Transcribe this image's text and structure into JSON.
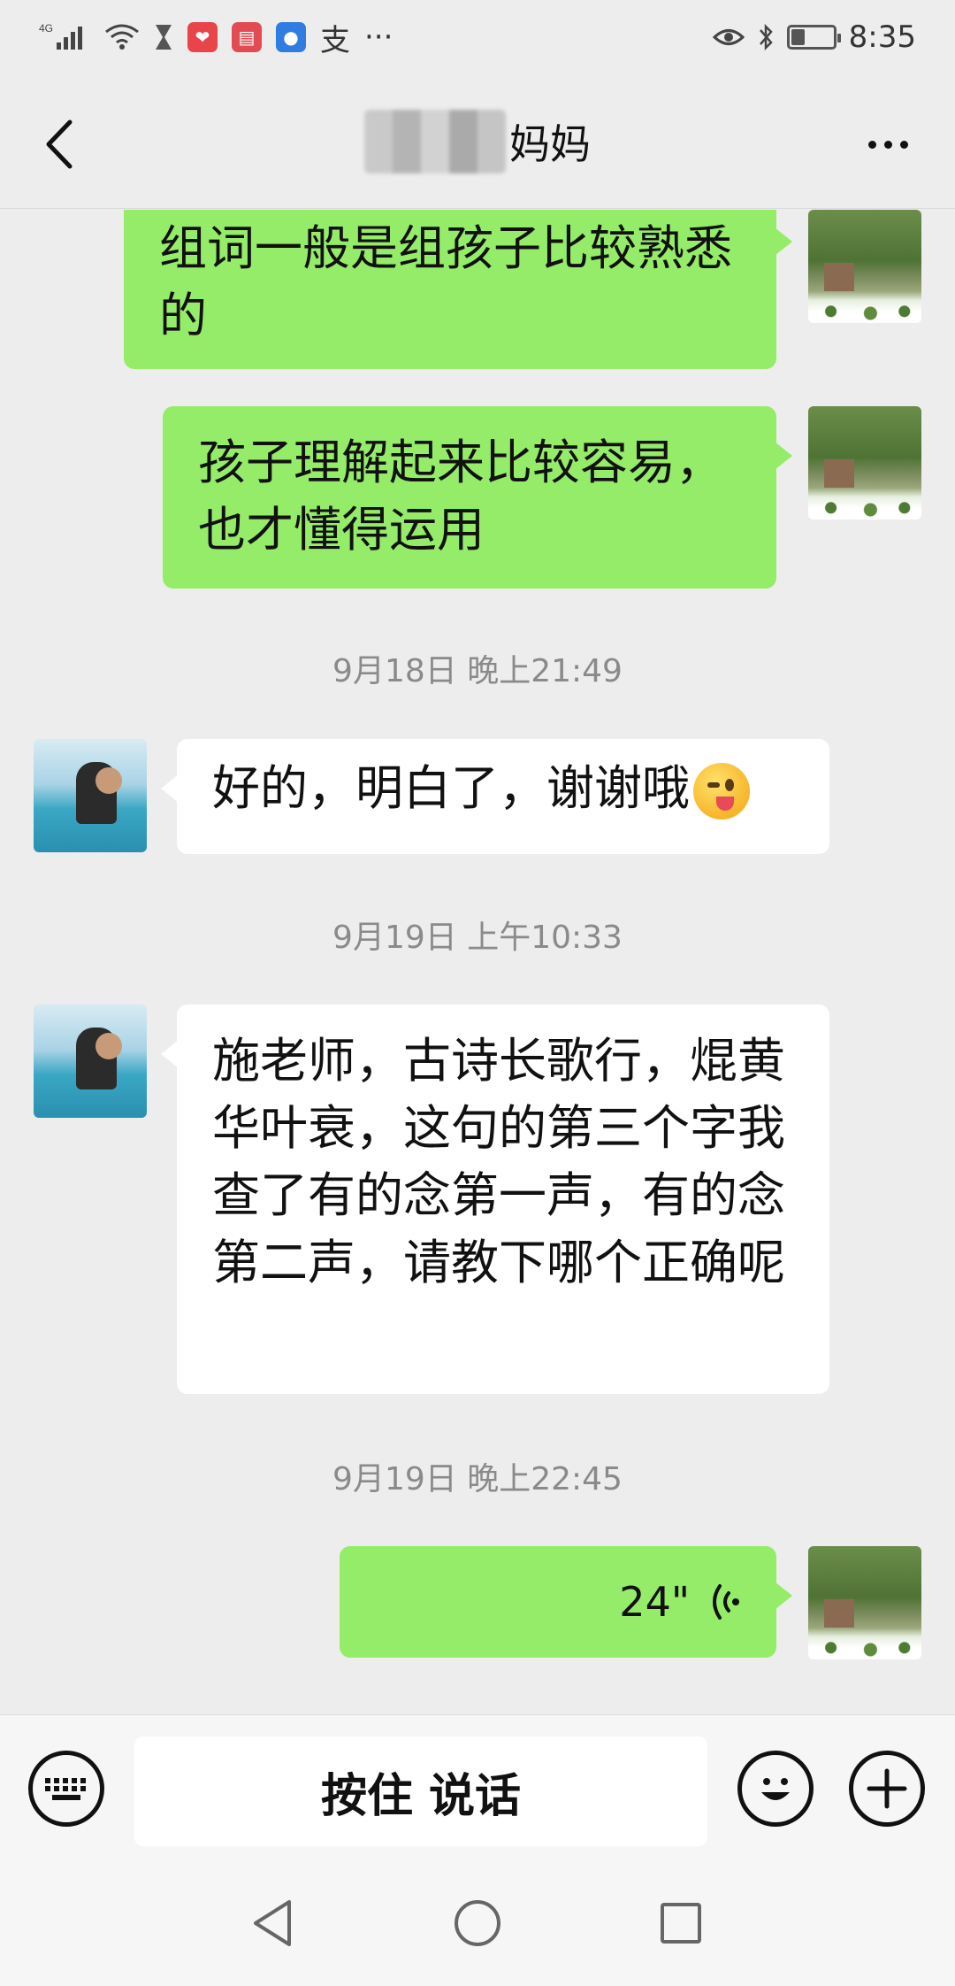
{
  "status_bar": {
    "network": "4G",
    "time": "8:35",
    "battery_level": 0.3
  },
  "header": {
    "title": "妈妈",
    "back_icon": "chevron-left-icon",
    "more_icon": "more-dots-icon"
  },
  "messages": [
    {
      "side": "me",
      "text": "组词一般是组孩子比较熟悉的"
    },
    {
      "side": "me",
      "text": "孩子理解起来比较容易，也才懂得运用"
    },
    {
      "type": "time",
      "text": "9月18日 晚上21:49"
    },
    {
      "side": "other",
      "text": "好的，明白了，谢谢哦",
      "emoji": "wink-tongue-emoji"
    },
    {
      "type": "time",
      "text": "9月19日 上午10:33"
    },
    {
      "side": "other",
      "text": "施老师，古诗长歌行，焜黄华叶衰，这句的第三个字我查了有的念第一声，有的念第二声，请教下哪个正确呢"
    },
    {
      "type": "time",
      "text": "9月19日 晚上22:45"
    },
    {
      "side": "me",
      "type": "voice",
      "duration": "24\""
    }
  ],
  "input_bar": {
    "hold_to_talk": "按住 说话",
    "keyboard_icon": "keyboard-icon",
    "emoji_icon": "smiley-icon",
    "plus_icon": "plus-icon"
  },
  "nav_bar": {
    "back_icon": "triangle-back-icon",
    "home_icon": "circle-home-icon",
    "recents_icon": "square-recents-icon"
  },
  "colors": {
    "background": "#ededed",
    "bubble_me": "#95ec69",
    "bubble_other": "#ffffff",
    "timestamp": "#8a8a8a"
  }
}
